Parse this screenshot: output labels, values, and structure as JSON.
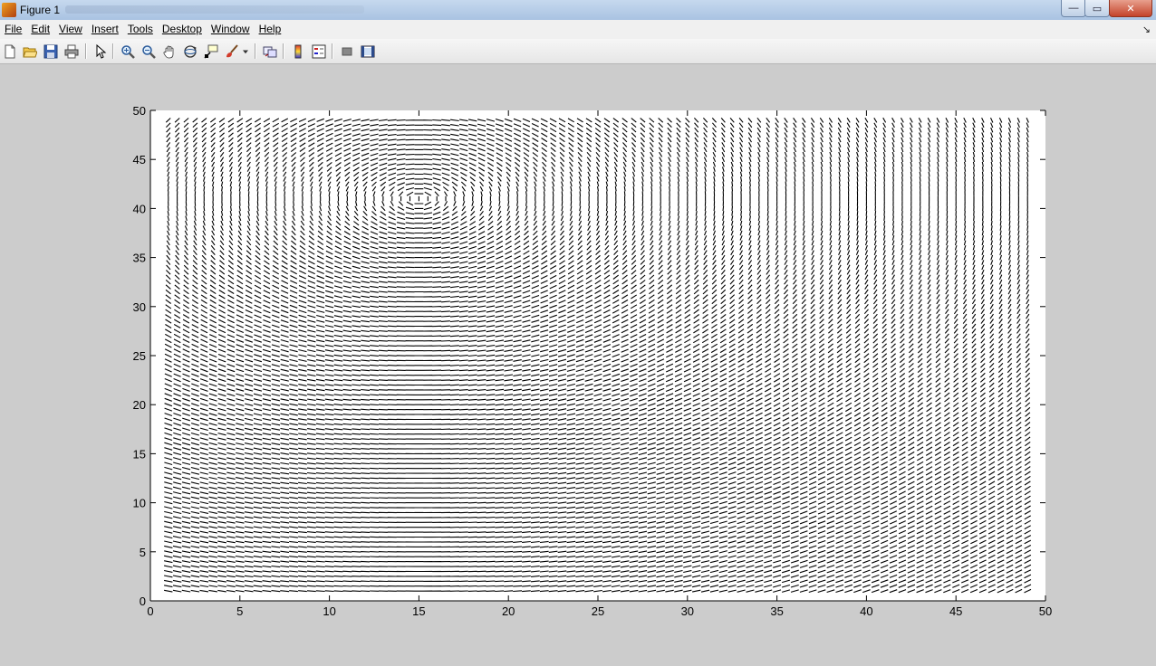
{
  "window": {
    "title": "Figure 1",
    "minimize_glyph": "—",
    "maximize_glyph": "▭",
    "close_glyph": "✕"
  },
  "menu": {
    "items": [
      {
        "label": "File"
      },
      {
        "label": "Edit"
      },
      {
        "label": "View"
      },
      {
        "label": "Insert"
      },
      {
        "label": "Tools"
      },
      {
        "label": "Desktop"
      },
      {
        "label": "Window"
      },
      {
        "label": "Help"
      }
    ],
    "dock_arrow": "↘"
  },
  "toolbar": {
    "icons": [
      "new-figure-icon",
      "open-file-icon",
      "save-figure-icon",
      "print-figure-icon",
      "edit-plot-arrow-icon",
      "zoom-in-icon",
      "zoom-out-icon",
      "pan-hand-icon",
      "rotate-3d-icon",
      "data-cursor-icon",
      "brush-icon",
      "brush-dropdown-icon",
      "link-plot-icon",
      "insert-colorbar-icon",
      "insert-legend-icon",
      "hide-plot-tools-icon",
      "show-plot-tools-icon"
    ]
  },
  "colors": {
    "background": "#cccccc",
    "axes_background": "#ffffff",
    "line_color": "#000000"
  },
  "chart_data": {
    "type": "quiver",
    "title": "",
    "xlabel": "",
    "ylabel": "",
    "xlim": [
      0,
      50
    ],
    "ylim": [
      0,
      50
    ],
    "xticks": [
      0,
      5,
      10,
      15,
      20,
      25,
      30,
      35,
      40,
      45,
      50
    ],
    "yticks": [
      0,
      5,
      10,
      15,
      20,
      25,
      30,
      35,
      40,
      45,
      50
    ],
    "xtick_labels": [
      "0",
      "5",
      "10",
      "15",
      "20",
      "25",
      "30",
      "35",
      "40",
      "45",
      "50"
    ],
    "ytick_labels": [
      "0",
      "5",
      "10",
      "15",
      "20",
      "25",
      "30",
      "35",
      "40",
      "45",
      "50"
    ],
    "grid": false,
    "grid_x_range": [
      1,
      49
    ],
    "grid_y_range": [
      1,
      49
    ],
    "grid_spacing": 0.5,
    "singular_point": [
      15,
      41
    ],
    "field": "orientation lines converging to singular point, near-horizontal above and below it, vertical along column x=15"
  }
}
